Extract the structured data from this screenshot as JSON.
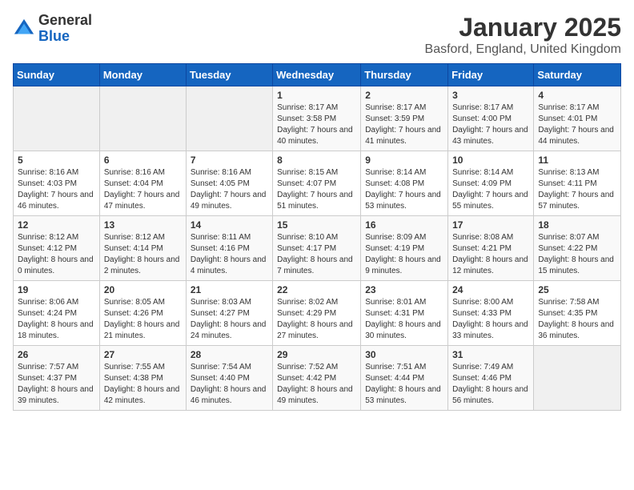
{
  "logo": {
    "general": "General",
    "blue": "Blue"
  },
  "title": {
    "month": "January 2025",
    "location": "Basford, England, United Kingdom"
  },
  "weekdays": [
    "Sunday",
    "Monday",
    "Tuesday",
    "Wednesday",
    "Thursday",
    "Friday",
    "Saturday"
  ],
  "weeks": [
    [
      {
        "day": "",
        "sunrise": "",
        "sunset": "",
        "daylight": ""
      },
      {
        "day": "",
        "sunrise": "",
        "sunset": "",
        "daylight": ""
      },
      {
        "day": "",
        "sunrise": "",
        "sunset": "",
        "daylight": ""
      },
      {
        "day": "1",
        "sunrise": "Sunrise: 8:17 AM",
        "sunset": "Sunset: 3:58 PM",
        "daylight": "Daylight: 7 hours and 40 minutes."
      },
      {
        "day": "2",
        "sunrise": "Sunrise: 8:17 AM",
        "sunset": "Sunset: 3:59 PM",
        "daylight": "Daylight: 7 hours and 41 minutes."
      },
      {
        "day": "3",
        "sunrise": "Sunrise: 8:17 AM",
        "sunset": "Sunset: 4:00 PM",
        "daylight": "Daylight: 7 hours and 43 minutes."
      },
      {
        "day": "4",
        "sunrise": "Sunrise: 8:17 AM",
        "sunset": "Sunset: 4:01 PM",
        "daylight": "Daylight: 7 hours and 44 minutes."
      }
    ],
    [
      {
        "day": "5",
        "sunrise": "Sunrise: 8:16 AM",
        "sunset": "Sunset: 4:03 PM",
        "daylight": "Daylight: 7 hours and 46 minutes."
      },
      {
        "day": "6",
        "sunrise": "Sunrise: 8:16 AM",
        "sunset": "Sunset: 4:04 PM",
        "daylight": "Daylight: 7 hours and 47 minutes."
      },
      {
        "day": "7",
        "sunrise": "Sunrise: 8:16 AM",
        "sunset": "Sunset: 4:05 PM",
        "daylight": "Daylight: 7 hours and 49 minutes."
      },
      {
        "day": "8",
        "sunrise": "Sunrise: 8:15 AM",
        "sunset": "Sunset: 4:07 PM",
        "daylight": "Daylight: 7 hours and 51 minutes."
      },
      {
        "day": "9",
        "sunrise": "Sunrise: 8:14 AM",
        "sunset": "Sunset: 4:08 PM",
        "daylight": "Daylight: 7 hours and 53 minutes."
      },
      {
        "day": "10",
        "sunrise": "Sunrise: 8:14 AM",
        "sunset": "Sunset: 4:09 PM",
        "daylight": "Daylight: 7 hours and 55 minutes."
      },
      {
        "day": "11",
        "sunrise": "Sunrise: 8:13 AM",
        "sunset": "Sunset: 4:11 PM",
        "daylight": "Daylight: 7 hours and 57 minutes."
      }
    ],
    [
      {
        "day": "12",
        "sunrise": "Sunrise: 8:12 AM",
        "sunset": "Sunset: 4:12 PM",
        "daylight": "Daylight: 8 hours and 0 minutes."
      },
      {
        "day": "13",
        "sunrise": "Sunrise: 8:12 AM",
        "sunset": "Sunset: 4:14 PM",
        "daylight": "Daylight: 8 hours and 2 minutes."
      },
      {
        "day": "14",
        "sunrise": "Sunrise: 8:11 AM",
        "sunset": "Sunset: 4:16 PM",
        "daylight": "Daylight: 8 hours and 4 minutes."
      },
      {
        "day": "15",
        "sunrise": "Sunrise: 8:10 AM",
        "sunset": "Sunset: 4:17 PM",
        "daylight": "Daylight: 8 hours and 7 minutes."
      },
      {
        "day": "16",
        "sunrise": "Sunrise: 8:09 AM",
        "sunset": "Sunset: 4:19 PM",
        "daylight": "Daylight: 8 hours and 9 minutes."
      },
      {
        "day": "17",
        "sunrise": "Sunrise: 8:08 AM",
        "sunset": "Sunset: 4:21 PM",
        "daylight": "Daylight: 8 hours and 12 minutes."
      },
      {
        "day": "18",
        "sunrise": "Sunrise: 8:07 AM",
        "sunset": "Sunset: 4:22 PM",
        "daylight": "Daylight: 8 hours and 15 minutes."
      }
    ],
    [
      {
        "day": "19",
        "sunrise": "Sunrise: 8:06 AM",
        "sunset": "Sunset: 4:24 PM",
        "daylight": "Daylight: 8 hours and 18 minutes."
      },
      {
        "day": "20",
        "sunrise": "Sunrise: 8:05 AM",
        "sunset": "Sunset: 4:26 PM",
        "daylight": "Daylight: 8 hours and 21 minutes."
      },
      {
        "day": "21",
        "sunrise": "Sunrise: 8:03 AM",
        "sunset": "Sunset: 4:27 PM",
        "daylight": "Daylight: 8 hours and 24 minutes."
      },
      {
        "day": "22",
        "sunrise": "Sunrise: 8:02 AM",
        "sunset": "Sunset: 4:29 PM",
        "daylight": "Daylight: 8 hours and 27 minutes."
      },
      {
        "day": "23",
        "sunrise": "Sunrise: 8:01 AM",
        "sunset": "Sunset: 4:31 PM",
        "daylight": "Daylight: 8 hours and 30 minutes."
      },
      {
        "day": "24",
        "sunrise": "Sunrise: 8:00 AM",
        "sunset": "Sunset: 4:33 PM",
        "daylight": "Daylight: 8 hours and 33 minutes."
      },
      {
        "day": "25",
        "sunrise": "Sunrise: 7:58 AM",
        "sunset": "Sunset: 4:35 PM",
        "daylight": "Daylight: 8 hours and 36 minutes."
      }
    ],
    [
      {
        "day": "26",
        "sunrise": "Sunrise: 7:57 AM",
        "sunset": "Sunset: 4:37 PM",
        "daylight": "Daylight: 8 hours and 39 minutes."
      },
      {
        "day": "27",
        "sunrise": "Sunrise: 7:55 AM",
        "sunset": "Sunset: 4:38 PM",
        "daylight": "Daylight: 8 hours and 42 minutes."
      },
      {
        "day": "28",
        "sunrise": "Sunrise: 7:54 AM",
        "sunset": "Sunset: 4:40 PM",
        "daylight": "Daylight: 8 hours and 46 minutes."
      },
      {
        "day": "29",
        "sunrise": "Sunrise: 7:52 AM",
        "sunset": "Sunset: 4:42 PM",
        "daylight": "Daylight: 8 hours and 49 minutes."
      },
      {
        "day": "30",
        "sunrise": "Sunrise: 7:51 AM",
        "sunset": "Sunset: 4:44 PM",
        "daylight": "Daylight: 8 hours and 53 minutes."
      },
      {
        "day": "31",
        "sunrise": "Sunrise: 7:49 AM",
        "sunset": "Sunset: 4:46 PM",
        "daylight": "Daylight: 8 hours and 56 minutes."
      },
      {
        "day": "",
        "sunrise": "",
        "sunset": "",
        "daylight": ""
      }
    ]
  ]
}
